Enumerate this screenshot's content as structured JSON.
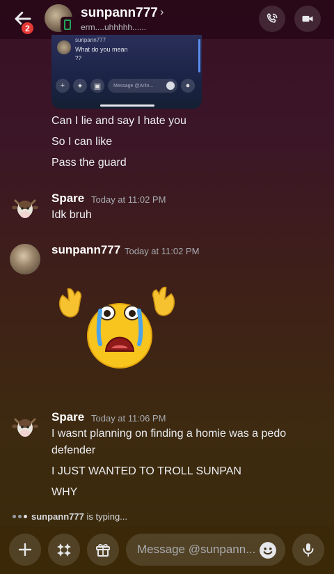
{
  "header": {
    "badge_count": "2",
    "name": "sunpann777",
    "chevron": "›",
    "status": "erm....uhhhhh......"
  },
  "embedded": {
    "name": "sunpann777",
    "line1": "What do you mean",
    "line2": "??",
    "input_placeholder": "Message @Arlin..."
  },
  "messages": {
    "lines1": [
      "Can I lie and say I hate you",
      "So I can like",
      "Pass the guard"
    ],
    "m1": {
      "user": "Spare",
      "time": "Today at 11:02 PM",
      "text": "Idk bruh"
    },
    "m2": {
      "user": "sunpann777",
      "time": "Today at 11:02 PM"
    },
    "m3": {
      "user": "Spare",
      "time": "Today at 11:06 PM",
      "line1": "I wasnt planning on finding a homie was a pedo",
      "line2": "defender",
      "line3": "I JUST WANTED TO TROLL SUNPAN",
      "line4": "WHY"
    }
  },
  "typing": {
    "user": "sunpann777",
    "suffix": "is typing..."
  },
  "composer": {
    "placeholder": "Message @sunpann..."
  },
  "colors": {
    "accent_green": "#23a55a",
    "badge_red": "#e53935"
  }
}
